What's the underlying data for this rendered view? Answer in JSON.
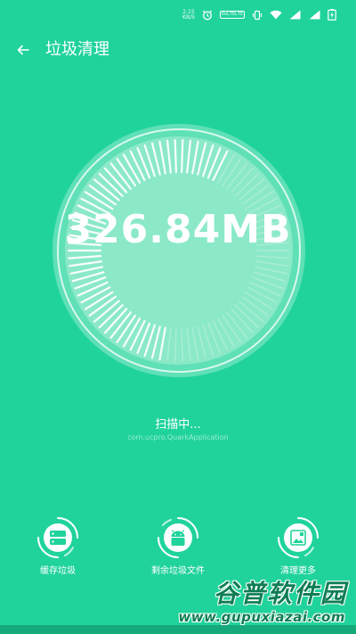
{
  "status_bar": {
    "speed_value": "2.15",
    "speed_unit": "KB/S",
    "volte_top": "VoLTE",
    "volte_bottom": "LTE",
    "network_label": "4G"
  },
  "header": {
    "title": "垃圾清理"
  },
  "scan": {
    "size_value": "326.84MB",
    "status": "扫描中...",
    "current_target": "com.ucpro.QuarkApplication",
    "progress_fraction": 0.55
  },
  "actions": [
    {
      "label": "缓存垃圾",
      "icon": "storage-icon"
    },
    {
      "label": "剩余垃圾文件",
      "icon": "android-icon"
    },
    {
      "label": "清理更多",
      "icon": "image-folder-icon"
    }
  ],
  "watermark": {
    "main": "谷普软件园",
    "sub": "www.gupuxiazai.com"
  },
  "colors": {
    "background": "#20d39b",
    "gauge_fill": "#8be9c8",
    "text": "#ffffff"
  }
}
